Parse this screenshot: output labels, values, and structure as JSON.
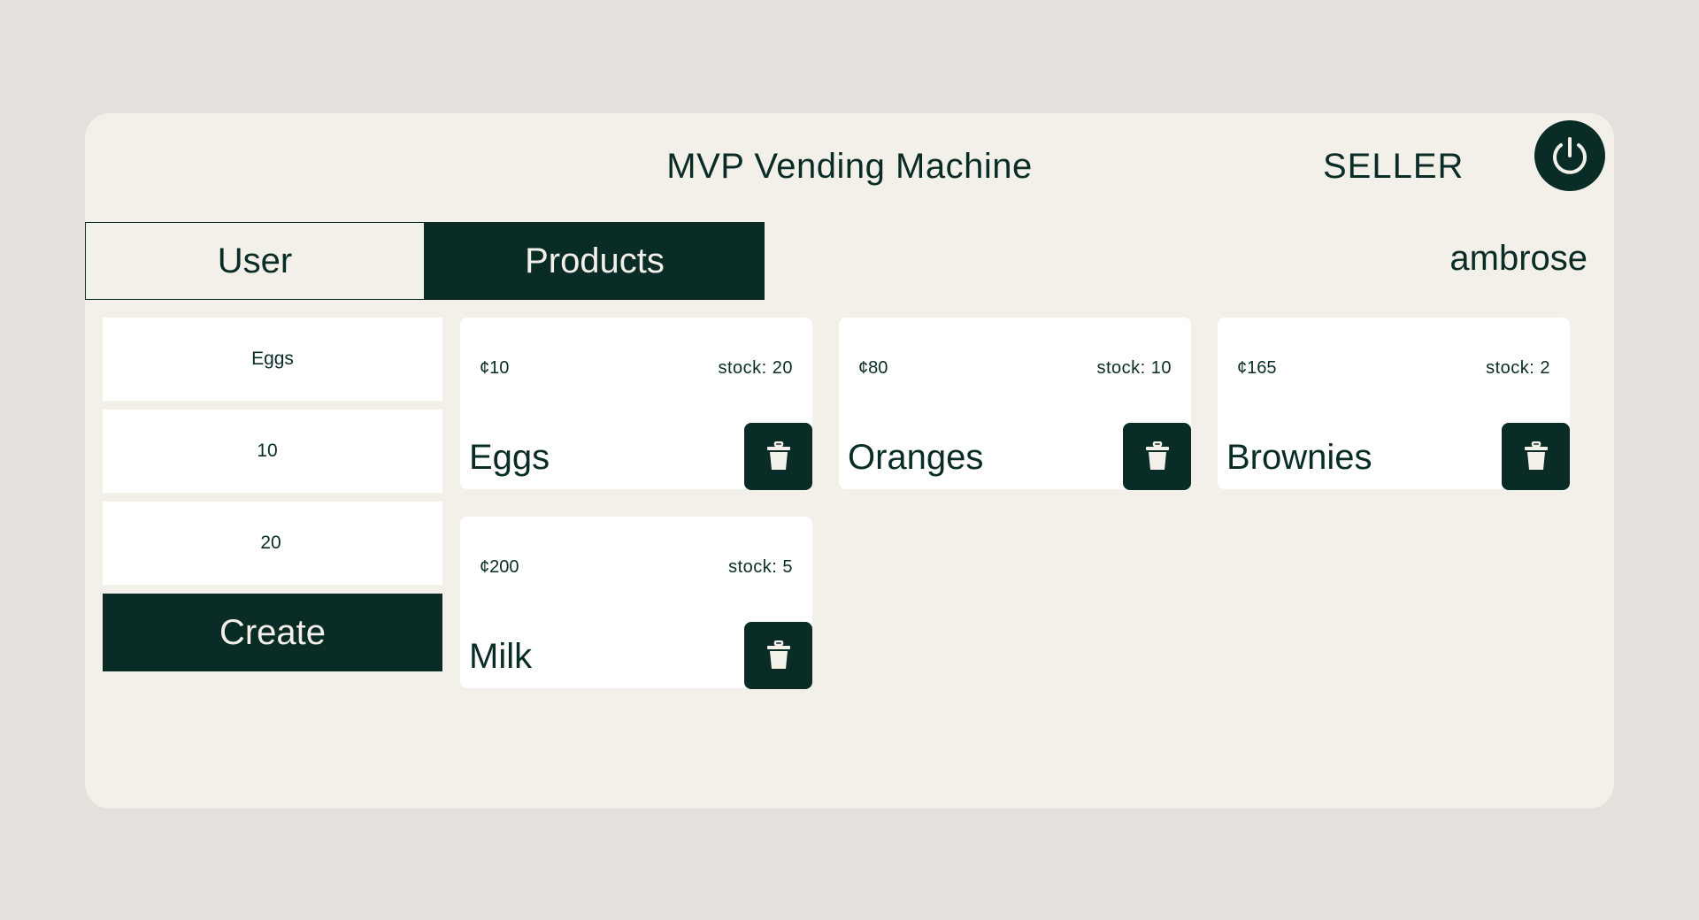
{
  "header": {
    "title": "MVP Vending Machine",
    "role": "SELLER",
    "power_icon": "power-icon"
  },
  "tabs": [
    {
      "label": "User",
      "active": false
    },
    {
      "label": "Products",
      "active": true
    }
  ],
  "username": "ambrose",
  "form": {
    "name_value": "Eggs",
    "cost_value": "10",
    "stock_value": "20",
    "create_label": "Create"
  },
  "products": [
    {
      "price": "¢10",
      "stock_label": "stock:",
      "stock": "20",
      "name": "Eggs"
    },
    {
      "price": "¢80",
      "stock_label": "stock:",
      "stock": "10",
      "name": "Oranges"
    },
    {
      "price": "¢165",
      "stock_label": "stock:",
      "stock": "2",
      "name": "Brownies"
    },
    {
      "price": "¢200",
      "stock_label": "stock:",
      "stock": "5",
      "name": "Milk"
    }
  ],
  "colors": {
    "background": "#e4e1dc",
    "panel": "#f3f0ea",
    "accent": "#0a2c26",
    "card": "#ffffff"
  },
  "icons": {
    "delete": "trash-icon",
    "logout": "power-icon"
  }
}
